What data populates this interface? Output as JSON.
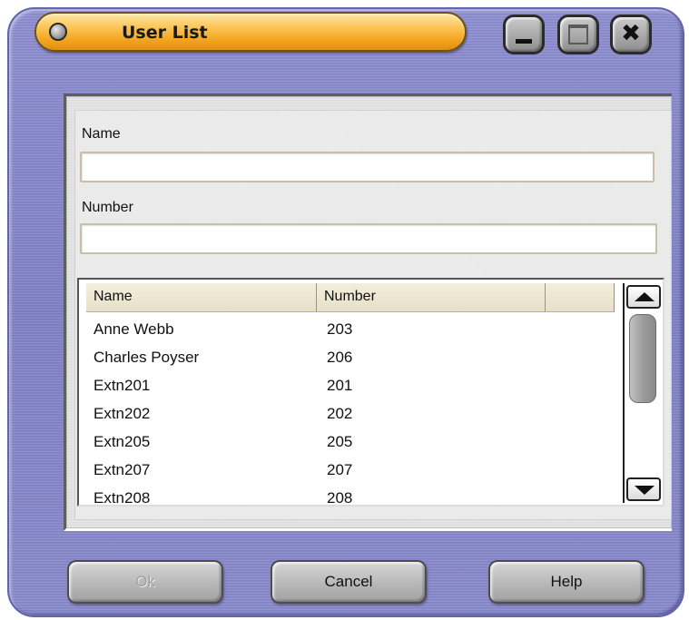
{
  "window": {
    "title": "User List"
  },
  "title_buttons": {
    "minimize_icon": "minimize-icon",
    "maximize_icon": "maximize-icon",
    "close_icon": "close-icon",
    "close_glyph": "✖"
  },
  "form": {
    "name_label": "Name",
    "name_value": "",
    "number_label": "Number",
    "number_value": ""
  },
  "list": {
    "columns": [
      "Name",
      "Number",
      ""
    ],
    "rows": [
      {
        "name": "Anne Webb",
        "number": "203"
      },
      {
        "name": "Charles Poyser",
        "number": "206"
      },
      {
        "name": "Extn201",
        "number": "201"
      },
      {
        "name": "Extn202",
        "number": "202"
      },
      {
        "name": "Extn205",
        "number": "205"
      },
      {
        "name": "Extn207",
        "number": "207"
      },
      {
        "name": "Extn208",
        "number": "208"
      }
    ]
  },
  "buttons": {
    "ok_label": "Ok",
    "cancel_label": "Cancel",
    "help_label": "Help"
  },
  "colors": {
    "frame": "#8b8ccf",
    "title_accent": "#fbc352",
    "panel": "#e4e4e4"
  }
}
